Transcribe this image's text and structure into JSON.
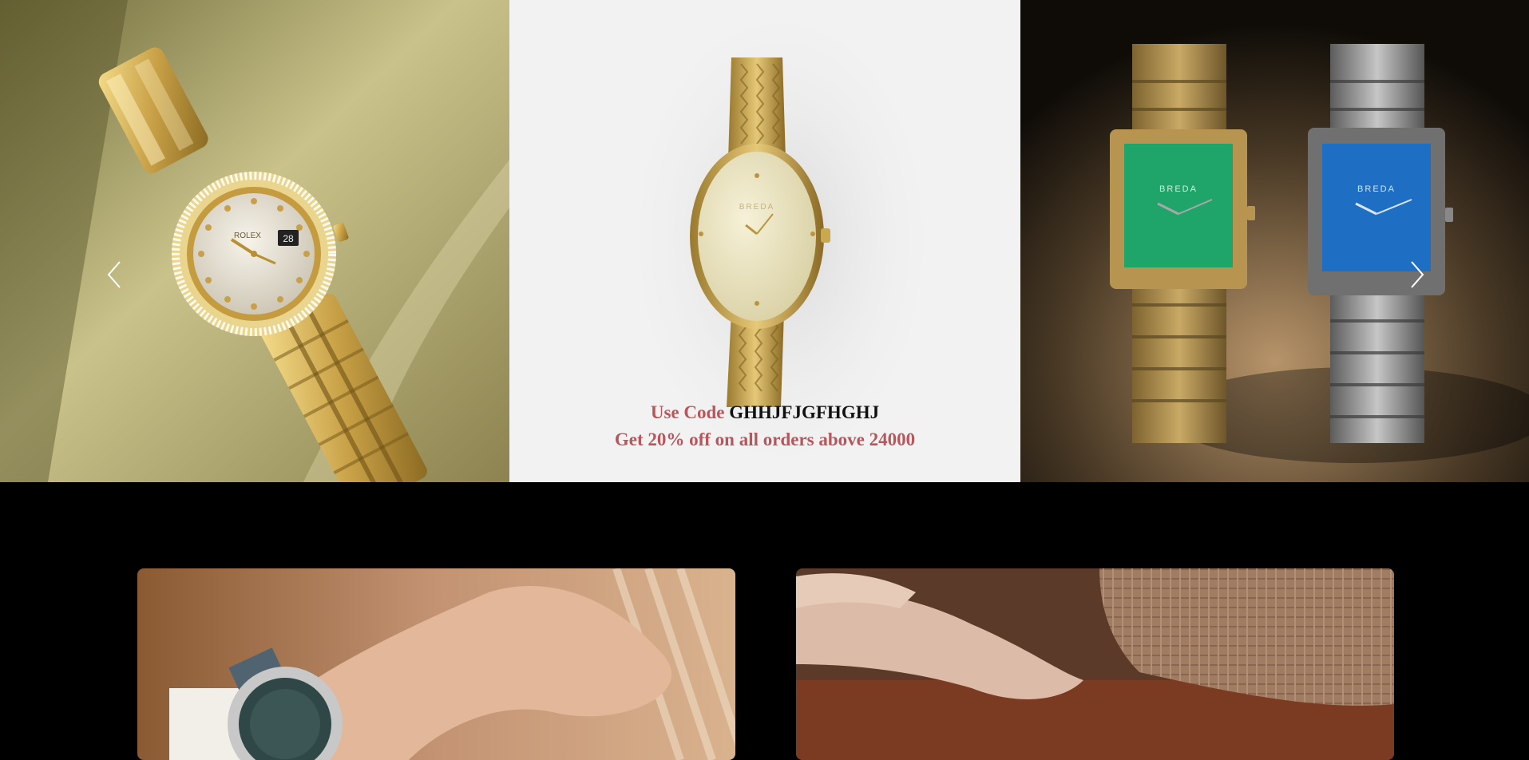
{
  "carousel": {
    "slides": [
      {
        "name": "Gold Rolex Datejust on sand",
        "brand_text": "ROLEX"
      },
      {
        "name": "Gold oval BREDA watch",
        "brand_text": "BREDA"
      },
      {
        "name": "BREDA square watches green and blue",
        "brand_text": "BREDA"
      }
    ],
    "promo": {
      "line1_prefix": "Use Code",
      "code": "GHHJFJGFHGHJ",
      "line2": "Get 20% off on all orders above 24000"
    },
    "prev_icon": "chevron-left-icon",
    "next_icon": "chevron-right-icon"
  },
  "cards": [
    {
      "name": "Wrist with dive watch lifestyle image"
    },
    {
      "name": "Tweed sleeve lifestyle image"
    }
  ],
  "colors": {
    "background": "#000000",
    "promo_text": "#b5575c",
    "code_text": "#111111"
  }
}
